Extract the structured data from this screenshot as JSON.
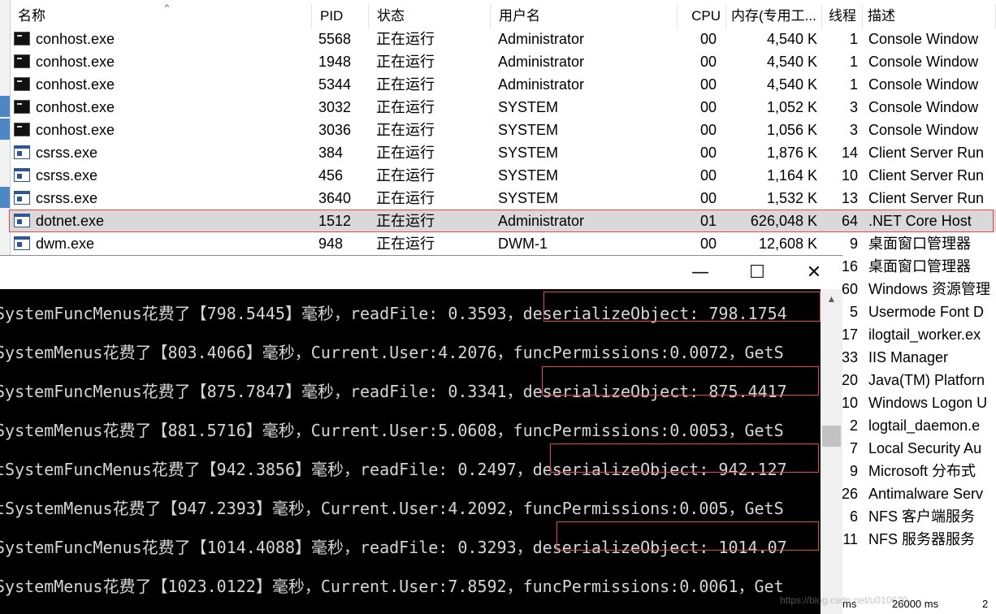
{
  "task_manager": {
    "headers": {
      "name": "名称",
      "pid": "PID",
      "status": "状态",
      "user": "用户名",
      "cpu": "CPU",
      "memory": "内存(专用工...",
      "threads": "线程",
      "description": "描述"
    },
    "rows": [
      {
        "icon": "console-icon",
        "name": "conhost.exe",
        "pid": "5568",
        "status": "正在运行",
        "user": "Administrator",
        "cpu": "00",
        "memory": "4,540 K",
        "threads": "1",
        "description": "Console Window"
      },
      {
        "icon": "console-icon",
        "name": "conhost.exe",
        "pid": "1948",
        "status": "正在运行",
        "user": "Administrator",
        "cpu": "00",
        "memory": "4,540 K",
        "threads": "1",
        "description": "Console Window"
      },
      {
        "icon": "console-icon",
        "name": "conhost.exe",
        "pid": "5344",
        "status": "正在运行",
        "user": "Administrator",
        "cpu": "00",
        "memory": "4,540 K",
        "threads": "1",
        "description": "Console Window"
      },
      {
        "icon": "console-icon",
        "name": "conhost.exe",
        "pid": "3032",
        "status": "正在运行",
        "user": "SYSTEM",
        "cpu": "00",
        "memory": "1,052 K",
        "threads": "3",
        "description": "Console Window"
      },
      {
        "icon": "console-icon",
        "name": "conhost.exe",
        "pid": "3036",
        "status": "正在运行",
        "user": "SYSTEM",
        "cpu": "00",
        "memory": "1,056 K",
        "threads": "3",
        "description": "Console Window"
      },
      {
        "icon": "window-icon",
        "name": "csrss.exe",
        "pid": "384",
        "status": "正在运行",
        "user": "SYSTEM",
        "cpu": "00",
        "memory": "1,876 K",
        "threads": "14",
        "description": "Client Server Run"
      },
      {
        "icon": "window-icon",
        "name": "csrss.exe",
        "pid": "456",
        "status": "正在运行",
        "user": "SYSTEM",
        "cpu": "00",
        "memory": "1,164 K",
        "threads": "10",
        "description": "Client Server Run"
      },
      {
        "icon": "window-icon",
        "name": "csrss.exe",
        "pid": "3640",
        "status": "正在运行",
        "user": "SYSTEM",
        "cpu": "00",
        "memory": "1,532 K",
        "threads": "13",
        "description": "Client Server Run"
      },
      {
        "icon": "window-icon",
        "name": "dotnet.exe",
        "pid": "1512",
        "status": "正在运行",
        "user": "Administrator",
        "cpu": "01",
        "memory": "626,048 K",
        "threads": "64",
        "description": ".NET Core Host",
        "selected": true
      },
      {
        "icon": "window-icon",
        "name": "dwm.exe",
        "pid": "948",
        "status": "正在运行",
        "user": "DWM-1",
        "cpu": "00",
        "memory": "12,608 K",
        "threads": "9",
        "description": "桌面窗口管理器"
      }
    ],
    "partial_rows": [
      {
        "threads": "16",
        "description": "桌面窗口管理器"
      },
      {
        "threads": "60",
        "description": "Windows 资源管理"
      },
      {
        "threads": "5",
        "description": "Usermode Font D"
      },
      {
        "threads": "17",
        "description": "ilogtail_worker.ex"
      },
      {
        "threads": "33",
        "description": "IIS Manager"
      },
      {
        "threads": "20",
        "description": "Java(TM) Platforn"
      },
      {
        "threads": "10",
        "description": "Windows Logon U"
      },
      {
        "threads": "2",
        "description": "logtail_daemon.e"
      },
      {
        "threads": "7",
        "description": "Local Security Au"
      },
      {
        "threads": "9",
        "description": "Microsoft 分布式"
      },
      {
        "threads": "26",
        "description": "Antimalware Serv"
      },
      {
        "threads": "6",
        "description": "NFS 客户端服务"
      },
      {
        "threads": "11",
        "description": "NFS 服务器服务"
      }
    ]
  },
  "console": {
    "buttons": {
      "minimize": "—",
      "maximize": "☐",
      "close": "✕"
    },
    "lines": [
      "SystemFuncMenus花费了【798.5445】毫秒，readFile: 0.3593，deserializeObject: 798.1754",
      "SystemMenus花费了【803.4066】毫秒，Current.User:4.2076，funcPermissions:0.0072，GetS",
      "SystemFuncMenus花费了【875.7847】毫秒，readFile: 0.3341，deserializeObject: 875.4417",
      "SystemMenus花费了【881.5716】毫秒，Current.User:5.0608，funcPermissions:0.0053，GetS",
      "tSystemFuncMenus花费了【942.3856】毫秒，readFile: 0.2497，deserializeObject: 942.127",
      "tSystemMenus花费了【947.2393】毫秒，Current.User:4.2092，funcPermissions:0.005，GetS",
      "SystemFuncMenus花费了【1014.4088】毫秒，readFile: 0.3293，deserializeObject: 1014.07",
      "SystemMenus花费了【1023.0122】毫秒，Current.User:7.8592，funcPermissions:0.0061，Get"
    ]
  },
  "status_bar": {
    "left": "ms",
    "middle": "26000 ms",
    "right": "2"
  },
  "watermark": "https://blog.csdn.net/u010620"
}
